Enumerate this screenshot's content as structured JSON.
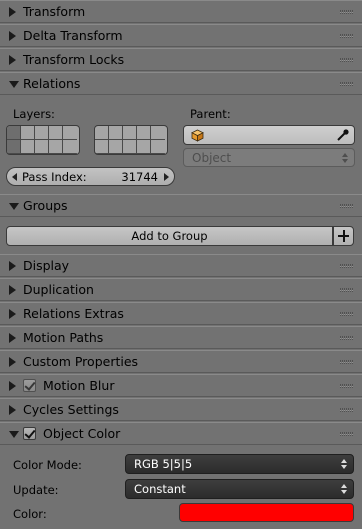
{
  "panels": {
    "transform": "Transform",
    "delta_transform": "Delta Transform",
    "transform_locks": "Transform Locks",
    "relations": "Relations",
    "groups": "Groups",
    "display": "Display",
    "duplication": "Duplication",
    "relations_extras": "Relations Extras",
    "motion_paths": "Motion Paths",
    "custom_properties": "Custom Properties",
    "motion_blur": "Motion Blur",
    "cycles_settings": "Cycles Settings",
    "object_color": "Object Color"
  },
  "relations": {
    "layers_label": "Layers:",
    "parent_label": "Parent:",
    "parent_value": "",
    "parent_type": "Object",
    "pass_index_label": "Pass Index:",
    "pass_index_value": "31744"
  },
  "groups": {
    "add_button": "Add to Group"
  },
  "object_color": {
    "color_mode_label": "Color Mode:",
    "color_mode_value": "RGB 5|5|5",
    "update_label": "Update:",
    "update_value": "Constant",
    "color_label": "Color:",
    "color_hex": "#ff0000"
  },
  "icons": {
    "expand": "triangle-right-icon",
    "collapse": "triangle-down-icon",
    "parent_object": "object-cube-icon",
    "eyedropper": "eyedropper-icon",
    "add": "plus-icon",
    "drag": "grip-icon"
  }
}
